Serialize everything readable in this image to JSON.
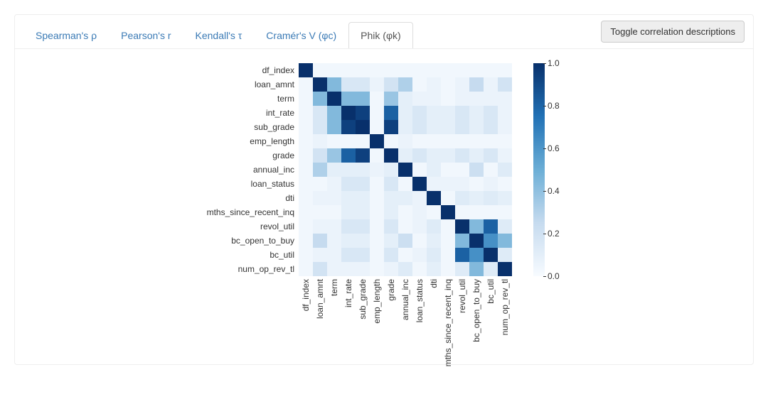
{
  "tabs": [
    {
      "label": "Spearman's ρ",
      "active": false
    },
    {
      "label": "Pearson's r",
      "active": false
    },
    {
      "label": "Kendall's τ",
      "active": false
    },
    {
      "label": "Cramér's V (φc)",
      "active": false
    },
    {
      "label": "Phik (φk)",
      "active": true
    }
  ],
  "toggle_button": "Toggle correlation descriptions",
  "chart_data": {
    "type": "heatmap",
    "title": "",
    "xlabel": "",
    "ylabel": "",
    "colorbar_range": [
      0.0,
      1.0
    ],
    "colorbar_ticks": [
      0.0,
      0.2,
      0.4,
      0.6,
      0.8,
      1.0
    ],
    "labels": [
      "df_index",
      "loan_amnt",
      "term",
      "int_rate",
      "sub_grade",
      "emp_length",
      "grade",
      "annual_inc",
      "loan_status",
      "dti",
      "mths_since_recent_inq",
      "revol_util",
      "bc_open_to_buy",
      "bc_util",
      "num_op_rev_tl"
    ],
    "matrix": [
      [
        1.0,
        0.05,
        0.05,
        0.05,
        0.05,
        0.05,
        0.05,
        0.05,
        0.05,
        0.05,
        0.05,
        0.05,
        0.05,
        0.05,
        0.05
      ],
      [
        0.05,
        1.0,
        0.55,
        0.25,
        0.25,
        0.1,
        0.3,
        0.45,
        0.05,
        0.1,
        0.05,
        0.1,
        0.4,
        0.1,
        0.3
      ],
      [
        0.05,
        0.55,
        1.0,
        0.55,
        0.55,
        0.05,
        0.5,
        0.15,
        0.1,
        0.1,
        0.05,
        0.1,
        0.1,
        0.1,
        0.1
      ],
      [
        0.05,
        0.25,
        0.55,
        1.0,
        0.95,
        0.05,
        0.85,
        0.15,
        0.25,
        0.15,
        0.15,
        0.25,
        0.15,
        0.25,
        0.1
      ],
      [
        0.05,
        0.25,
        0.55,
        0.95,
        1.0,
        0.05,
        0.95,
        0.15,
        0.25,
        0.15,
        0.15,
        0.25,
        0.15,
        0.25,
        0.1
      ],
      [
        0.05,
        0.1,
        0.05,
        0.05,
        0.05,
        1.0,
        0.05,
        0.1,
        0.05,
        0.05,
        0.05,
        0.05,
        0.05,
        0.05,
        0.05
      ],
      [
        0.05,
        0.3,
        0.5,
        0.85,
        0.95,
        0.05,
        1.0,
        0.15,
        0.25,
        0.15,
        0.15,
        0.25,
        0.15,
        0.25,
        0.1
      ],
      [
        0.05,
        0.45,
        0.15,
        0.15,
        0.15,
        0.1,
        0.15,
        1.0,
        0.05,
        0.15,
        0.05,
        0.05,
        0.35,
        0.05,
        0.2
      ],
      [
        0.05,
        0.05,
        0.1,
        0.25,
        0.25,
        0.05,
        0.25,
        0.05,
        1.0,
        0.1,
        0.1,
        0.1,
        0.05,
        0.1,
        0.05
      ],
      [
        0.05,
        0.1,
        0.1,
        0.15,
        0.15,
        0.05,
        0.15,
        0.15,
        0.1,
        1.0,
        0.05,
        0.2,
        0.15,
        0.2,
        0.15
      ],
      [
        0.05,
        0.05,
        0.05,
        0.15,
        0.15,
        0.05,
        0.15,
        0.05,
        0.1,
        0.05,
        1.0,
        0.05,
        0.05,
        0.05,
        0.05
      ],
      [
        0.05,
        0.1,
        0.1,
        0.25,
        0.25,
        0.05,
        0.25,
        0.05,
        0.1,
        0.2,
        0.05,
        1.0,
        0.55,
        0.85,
        0.2
      ],
      [
        0.05,
        0.4,
        0.1,
        0.15,
        0.15,
        0.05,
        0.15,
        0.35,
        0.05,
        0.15,
        0.05,
        0.55,
        1.0,
        0.7,
        0.55
      ],
      [
        0.05,
        0.1,
        0.1,
        0.25,
        0.25,
        0.05,
        0.25,
        0.05,
        0.1,
        0.2,
        0.05,
        0.85,
        0.7,
        1.0,
        0.2
      ],
      [
        0.05,
        0.3,
        0.1,
        0.1,
        0.1,
        0.05,
        0.1,
        0.2,
        0.05,
        0.15,
        0.05,
        0.2,
        0.55,
        0.2,
        1.0
      ]
    ]
  }
}
